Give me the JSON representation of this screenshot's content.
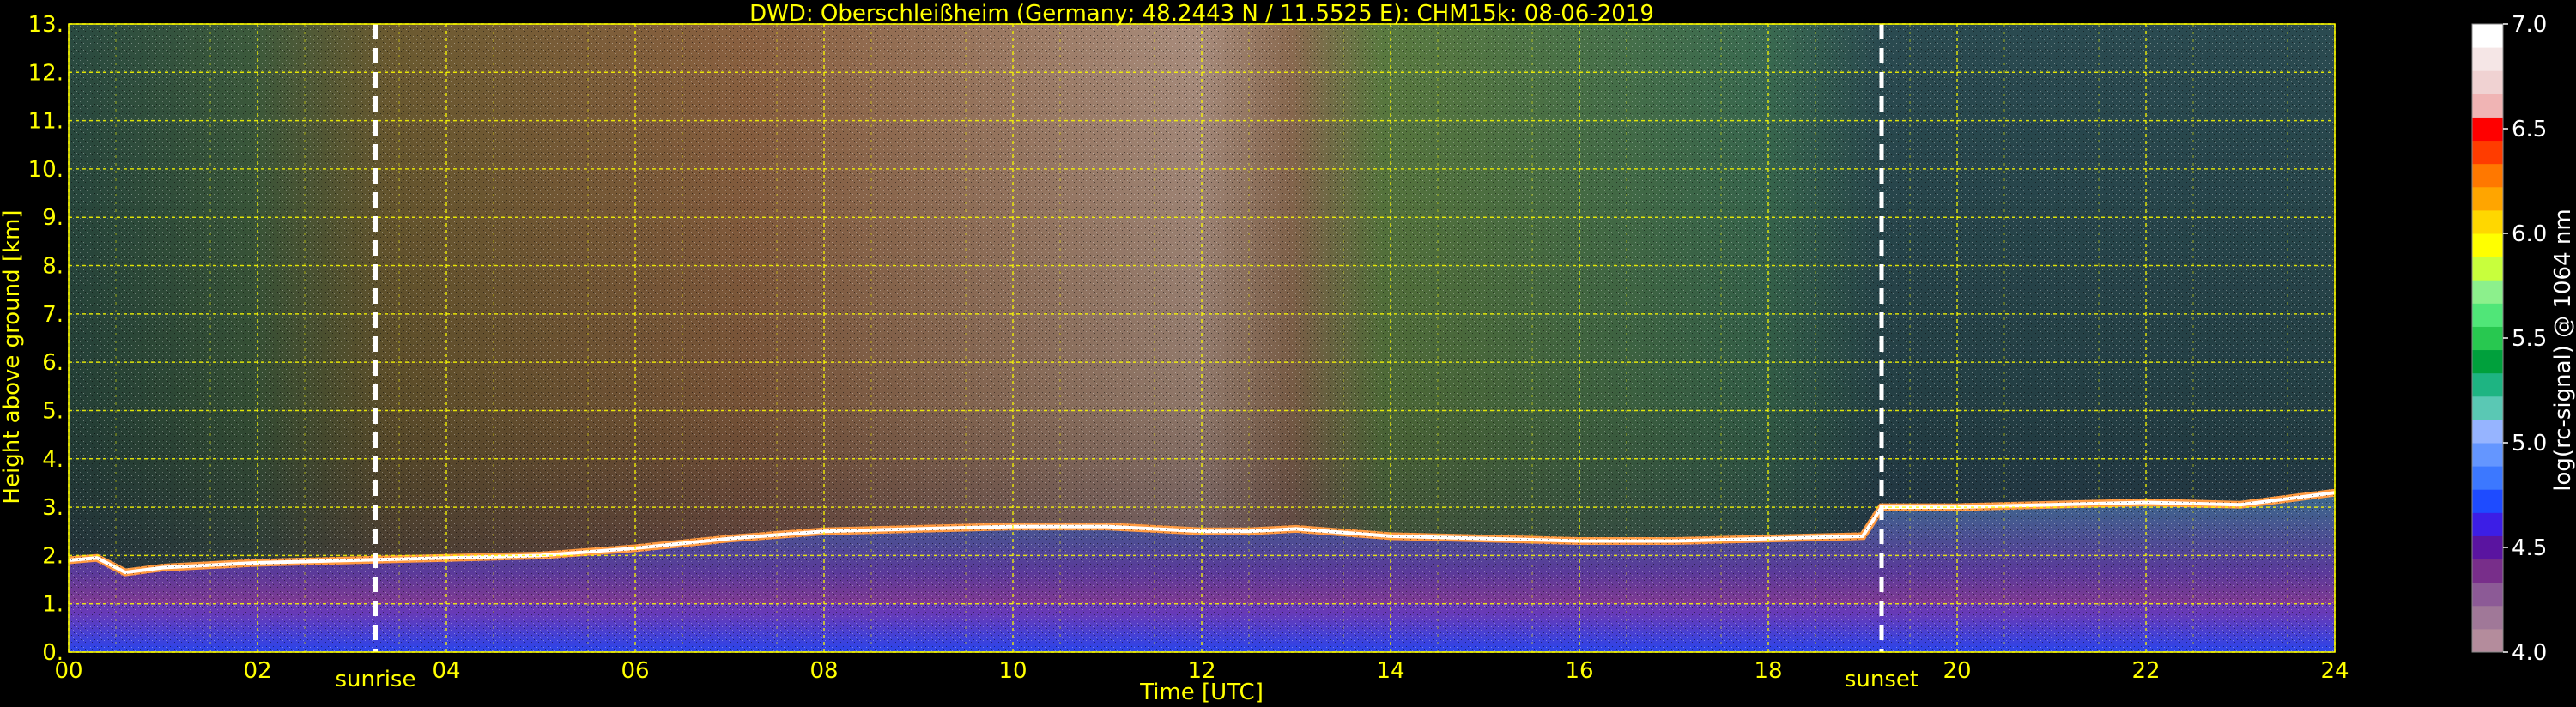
{
  "chart_data": {
    "type": "heatmap",
    "title": "DWD: Oberschleißheim (Germany; 48.2443 N / 11.5525 E):    CHM15k: 08-06-2019",
    "xlabel": "Time [UTC]",
    "ylabel": "Height above ground [km]",
    "xlim": [
      0,
      24
    ],
    "ylim": [
      0,
      13
    ],
    "x_ticks": [
      "00",
      "02",
      "04",
      "06",
      "08",
      "10",
      "12",
      "14",
      "16",
      "18",
      "20",
      "22",
      "24"
    ],
    "y_ticks": [
      "0.",
      "1.",
      "2.",
      "3.",
      "4.",
      "5.",
      "6.",
      "7.",
      "8.",
      "9.",
      "10.",
      "11.",
      "12.",
      "13."
    ],
    "grid": true,
    "colorbar": {
      "label": "log(rc-signal) @ 1064 nm",
      "range": [
        4.0,
        7.0
      ],
      "ticks": [
        "4.0",
        "4.5",
        "5.0",
        "5.5",
        "6.0",
        "6.5",
        "7.0"
      ],
      "colors": [
        "#b48c9c",
        "#a07898",
        "#8c5a96",
        "#782e8a",
        "#5a14a0",
        "#3c1ee6",
        "#1e4bff",
        "#3c78ff",
        "#6496ff",
        "#96b4ff",
        "#5ac8b4",
        "#1eb482",
        "#00a03c",
        "#28c850",
        "#50e678",
        "#8cf08c",
        "#c8ff3c",
        "#ffff00",
        "#ffd700",
        "#ffa500",
        "#ff7800",
        "#ff3c00",
        "#ff0000",
        "#f0b4b4",
        "#f0d2d2",
        "#f5e6e6",
        "#ffffff"
      ]
    },
    "markers": [
      {
        "label": "sunrise",
        "x": 3.25
      },
      {
        "label": "sunset",
        "x": 19.2
      }
    ],
    "boundary_layer_top_km": {
      "x": [
        0,
        0.3,
        0.6,
        1,
        2,
        3,
        4,
        5,
        6,
        7,
        8,
        9,
        10,
        11,
        12,
        12.5,
        13,
        14,
        15,
        16,
        17,
        18,
        19,
        19.2,
        20,
        21,
        22,
        23,
        24
      ],
      "y": [
        1.9,
        1.95,
        1.65,
        1.75,
        1.85,
        1.9,
        1.95,
        2.0,
        2.15,
        2.35,
        2.5,
        2.55,
        2.6,
        2.6,
        2.5,
        2.5,
        2.55,
        2.4,
        2.35,
        2.3,
        2.3,
        2.35,
        2.4,
        3.0,
        3.0,
        3.05,
        3.1,
        3.05,
        3.3
      ]
    }
  }
}
